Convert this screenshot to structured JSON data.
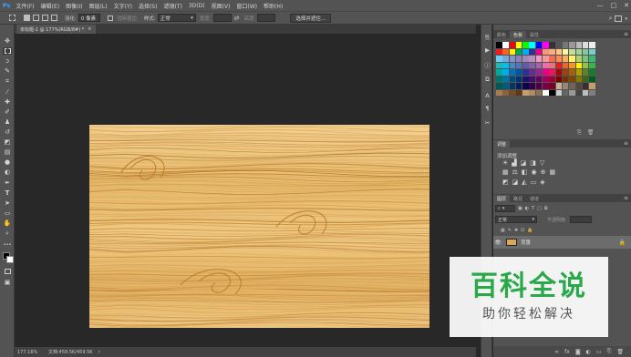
{
  "app": {
    "logo": "Ps"
  },
  "menu": [
    "文件(F)",
    "编辑(E)",
    "图像(I)",
    "图层(L)",
    "文字(Y)",
    "选择(S)",
    "滤镜(T)",
    "3D(D)",
    "视图(V)",
    "窗口(W)",
    "帮助(H)"
  ],
  "window_controls": {
    "minimize": "—",
    "maximize": "□",
    "close": "✕"
  },
  "options": {
    "feather_label": "羽化:",
    "feather_value": "0 像素",
    "antialias_label": "消除锯齿",
    "style_label": "样式:",
    "style_value": "正常",
    "width_label": "宽度:",
    "height_label": "高度:",
    "select_mask_button": "选择并遮住..."
  },
  "document": {
    "tab_title": "未标题-1 @ 177%(RGB/8#) *",
    "close": "×",
    "zoom": "177.16%",
    "doc_info": "文档:459.5K/459.5K"
  },
  "panels": {
    "color_tabs": [
      "颜色",
      "色板",
      "属性"
    ],
    "adjustments_title": "调整",
    "add_adjustment_label": "添加调整",
    "layers_tabs": [
      "图层",
      "路径",
      "通道"
    ],
    "blend_mode": "正常",
    "opacity_label": "不透明度:",
    "layer_name": "背景"
  },
  "colors": {
    "swatches": [
      [
        "#000000",
        "#ffffff",
        "#ff0000",
        "#ffff00",
        "#00ff00",
        "#00ffff",
        "#0000ff",
        "#ff00ff",
        "#333333",
        "#555555",
        "#777777",
        "#999999",
        "#bbbbbb",
        "#dddddd",
        "#eeeeee"
      ],
      [
        "#ee1d24",
        "#f26522",
        "#fff200",
        "#00a651",
        "#00aeef",
        "#2e3192",
        "#ec008c",
        "#f7977a",
        "#fbad82",
        "#fdc68c",
        "#fff79a",
        "#c4df9b",
        "#a3d39c",
        "#82ca9c",
        "#7bcdc8"
      ],
      [
        "#6dcff6",
        "#7da7d8",
        "#8493ca",
        "#8882be",
        "#a187be",
        "#bc8dbf",
        "#f49ac2",
        "#f6989d",
        "#f26c4f",
        "#f68e55",
        "#fbaf5a",
        "#fff467",
        "#acd372",
        "#7cc576",
        "#3bb878"
      ],
      [
        "#1abbb4",
        "#00bff3",
        "#438ccb",
        "#5574b9",
        "#605ca8",
        "#8560a8",
        "#a763a9",
        "#f06eaa",
        "#f26d7d",
        "#ed1c24",
        "#f26522",
        "#f7941d",
        "#fff200",
        "#8dc63f",
        "#39b54a"
      ],
      [
        "#00a99d",
        "#00aeef",
        "#0072bc",
        "#0054a5",
        "#2e3192",
        "#662d91",
        "#92278f",
        "#ec008c",
        "#ed145b",
        "#9e0b0f",
        "#a0410d",
        "#a3620a",
        "#aba000",
        "#598527",
        "#197b30"
      ],
      [
        "#00746b",
        "#0076a3",
        "#004a80",
        "#003471",
        "#1b1464",
        "#440e62",
        "#630460",
        "#9e005d",
        "#9e0039",
        "#790000",
        "#7b2e00",
        "#7d4900",
        "#827b00",
        "#406618",
        "#005e20"
      ],
      [
        "#005952",
        "#005b7f",
        "#003663",
        "#002157",
        "#0d004c",
        "#32004b",
        "#4b0049",
        "#7b0046",
        "#7a0026",
        "#c7b299",
        "#998675",
        "#736357",
        "#534741",
        "#37302a",
        "#c69c6d"
      ],
      [
        "#a67c52",
        "#8c6239",
        "#754c24",
        "#603913",
        "#c69c6d",
        "#b08b5c",
        "#8e7152",
        "#ffffff",
        "#000000",
        "#cccccc",
        "#666666",
        "#999999",
        "#444444",
        "#bfbfbf",
        "#7f7f7f"
      ]
    ]
  },
  "icons": {
    "tools": [
      "move-icon",
      "marquee-icon",
      "lasso-icon",
      "quick-select-icon",
      "crop-icon",
      "eyedropper-icon",
      "healing-icon",
      "brush-icon",
      "stamp-icon",
      "history-brush-icon",
      "eraser-icon",
      "gradient-icon",
      "blur-icon",
      "dodge-icon",
      "pen-icon",
      "type-icon",
      "path-select-icon",
      "shape-icon",
      "hand-icon",
      "zoom-icon"
    ]
  },
  "watermark": {
    "title": "百科全说",
    "subtitle": "助你轻松解决"
  }
}
